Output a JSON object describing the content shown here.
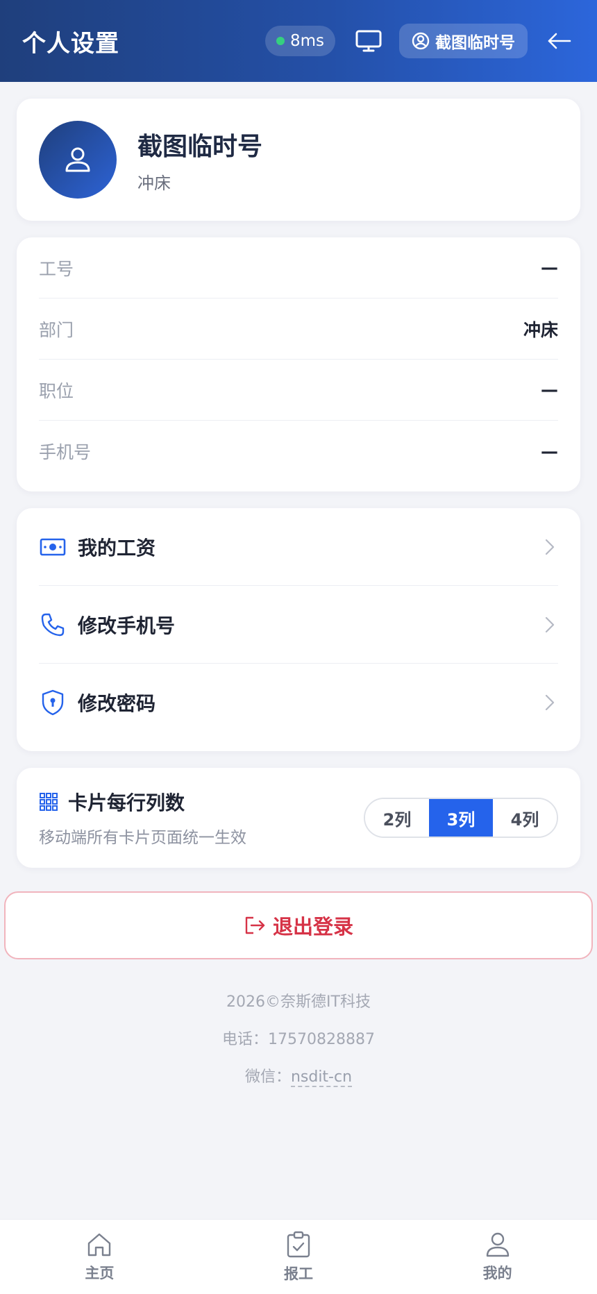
{
  "header": {
    "title": "个人设置",
    "latency": "8ms",
    "user_name": "截图临时号",
    "icons": [
      "monitor-icon",
      "user-circle-icon",
      "arrow-left-icon"
    ]
  },
  "profile": {
    "name": "截图临时号",
    "department": "冲床"
  },
  "info": {
    "rows": [
      {
        "label": "工号",
        "value": "—"
      },
      {
        "label": "部门",
        "value": "冲床"
      },
      {
        "label": "职位",
        "value": "—"
      },
      {
        "label": "手机号",
        "value": "—"
      }
    ]
  },
  "menu": {
    "items": [
      {
        "label": "我的工资",
        "icon": "money-icon"
      },
      {
        "label": "修改手机号",
        "icon": "phone-icon"
      },
      {
        "label": "修改密码",
        "icon": "shield-lock-icon"
      }
    ]
  },
  "columns": {
    "title": "卡片每行列数",
    "subtitle": "移动端所有卡片页面统一生效",
    "options": [
      "2列",
      "3列",
      "4列"
    ],
    "selected": "3列"
  },
  "logout": {
    "label": "退出登录"
  },
  "footer": {
    "copyright": "2026©奈斯德IT科技",
    "phone": "电话：17570828887",
    "wechat_label": "微信：",
    "wechat_id": "nsdit-cn"
  },
  "bottom_nav": {
    "items": [
      {
        "label": "主页",
        "icon": "home-icon"
      },
      {
        "label": "报工",
        "icon": "clipboard-check-icon"
      },
      {
        "label": "我的",
        "icon": "user-icon"
      }
    ]
  },
  "colors": {
    "primary": "#2563eb",
    "header_start": "#1f3f7c",
    "header_end": "#2c66db",
    "danger": "#d63347",
    "online": "#35d07f"
  }
}
